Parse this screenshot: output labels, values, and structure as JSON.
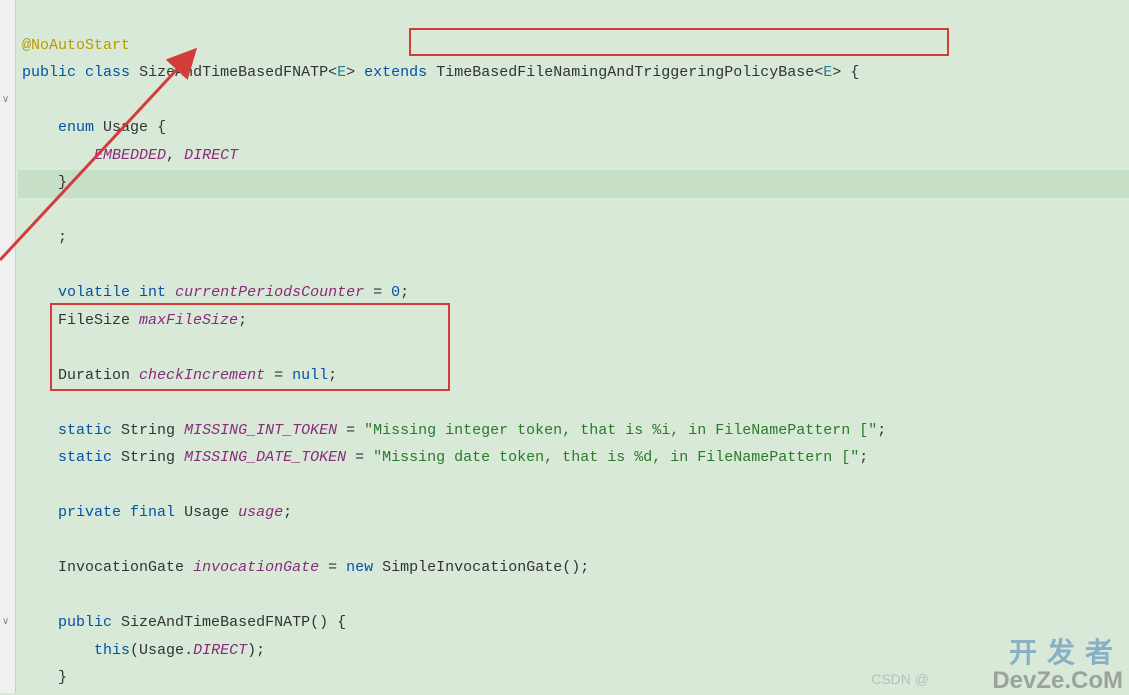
{
  "code": {
    "annotation": "@NoAutoStart",
    "kw_public": "public",
    "kw_class": "class",
    "class_name": "SizeAndTimeBasedFNATP",
    "generic_open": "<",
    "generic_E": "E",
    "generic_close": ">",
    "kw_extends": "extends",
    "base_class": "TimeBasedFileNamingAndTriggeringPolicyBase",
    "brace_open": "{",
    "brace_close": "}",
    "kw_enum": "enum",
    "enum_name": "Usage",
    "enum_val1": "EMBEDDED",
    "enum_sep": ",",
    "enum_val2": "DIRECT",
    "semicolon": ";",
    "kw_volatile": "volatile",
    "kw_int": "int",
    "fld_counter": "currentPeriodsCounter",
    "eq": "=",
    "zero": "0",
    "type_FileSize": "FileSize",
    "fld_maxFileSize": "maxFileSize",
    "type_Duration": "Duration",
    "fld_checkIncrement": "checkIncrement",
    "kw_null": "null",
    "kw_static": "static",
    "type_String": "String",
    "const_missing_int": "MISSING_INT_TOKEN",
    "str_missing_int": "\"Missing integer token, that is %i, in FileNamePattern [\"",
    "const_missing_date": "MISSING_DATE_TOKEN",
    "str_missing_date": "\"Missing date token, that is %d, in FileNamePattern [\"",
    "kw_private": "private",
    "kw_final": "final",
    "type_Usage": "Usage",
    "fld_usage": "usage",
    "type_InvocationGate": "InvocationGate",
    "fld_invocationGate": "invocationGate",
    "kw_new": "new",
    "ctor_SimpleGate": "SimpleInvocationGate",
    "parens": "()",
    "ctor_name": "SizeAndTimeBasedFNATP",
    "kw_this": "this",
    "usage_ref": "Usage",
    "dot": ".",
    "direct_ref": "DIRECT"
  },
  "watermark": {
    "cn": "开发者",
    "en": "DevZe.CoM",
    "csdn": "CSDN @"
  }
}
